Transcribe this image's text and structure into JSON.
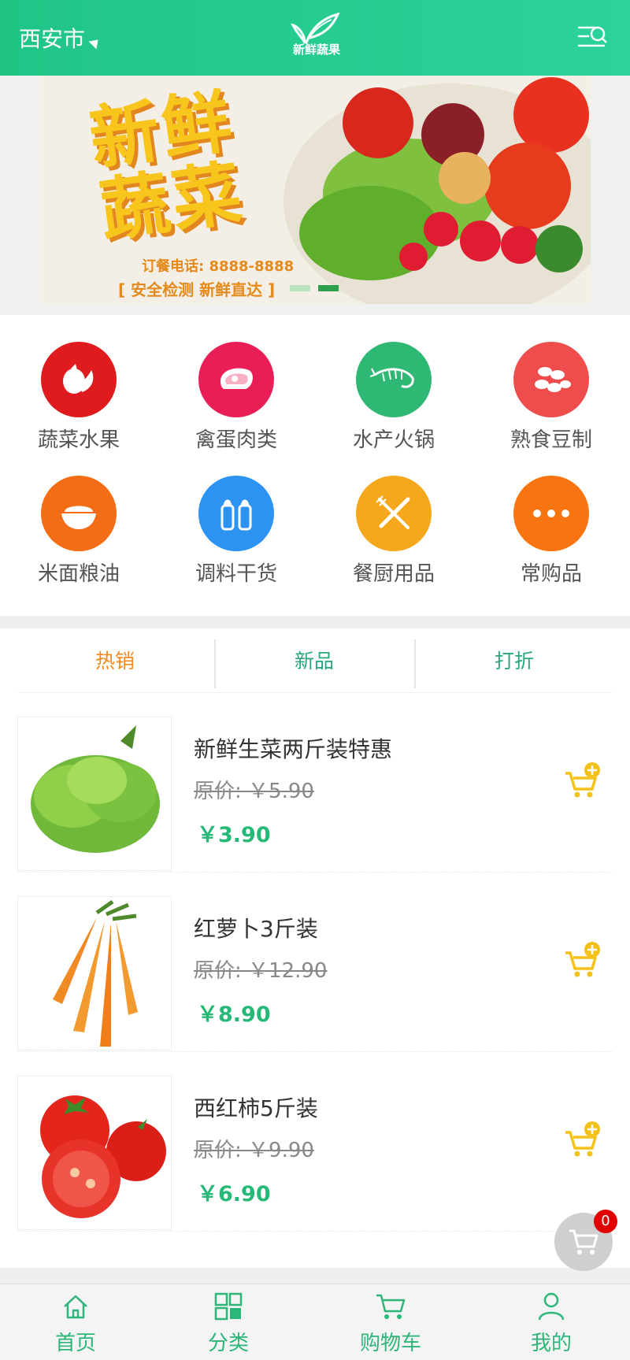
{
  "header": {
    "city": "西安市",
    "logo_text": "新鲜蔬果"
  },
  "banner": {
    "title": "新鲜蔬菜",
    "phone": "订餐电话: 8888-8888",
    "slogan": "[ 安全检测 新鲜直达 ]",
    "slides": 2,
    "active_slide": 2
  },
  "categories": [
    {
      "label": "蔬菜水果",
      "icon": "vegetable-icon",
      "color": "#e01b1f"
    },
    {
      "label": "禽蛋肉类",
      "icon": "meat-icon",
      "color": "#ea1e56"
    },
    {
      "label": "水产火锅",
      "icon": "shrimp-icon",
      "color": "#2eb874"
    },
    {
      "label": "熟食豆制",
      "icon": "beans-icon",
      "color": "#ef4c4c"
    },
    {
      "label": "米面粮油",
      "icon": "rice-bowl-icon",
      "color": "#f26d14"
    },
    {
      "label": "调料干货",
      "icon": "spice-bottles-icon",
      "color": "#2d93f2"
    },
    {
      "label": "餐厨用品",
      "icon": "fork-knife-icon",
      "color": "#f5a81c"
    },
    {
      "label": "常购品",
      "icon": "more-icon",
      "color": "#f77410"
    }
  ],
  "tabs": [
    {
      "label": "热销",
      "color": "#f28a1f"
    },
    {
      "label": "新品",
      "color": "#2aa77a"
    },
    {
      "label": "打折",
      "color": "#2aa77a"
    }
  ],
  "products": [
    {
      "name": "新鲜生菜两斤装特惠",
      "original": "原价: ￥5.90",
      "price": "￥3.90",
      "image": "lettuce"
    },
    {
      "name": "红萝卜3斤装",
      "original": "原价: ￥12.90",
      "price": "￥8.90",
      "image": "carrot"
    },
    {
      "name": "西红柿5斤装",
      "original": "原价: ￥9.90",
      "price": "￥6.90",
      "image": "tomato"
    }
  ],
  "cart_badge": "0",
  "bottom_nav": [
    {
      "label": "首页",
      "icon": "home-icon"
    },
    {
      "label": "分类",
      "icon": "category-icon"
    },
    {
      "label": "购物车",
      "icon": "cart-icon"
    },
    {
      "label": "我的",
      "icon": "user-icon"
    }
  ],
  "colors": {
    "brand": "#22c88c",
    "price": "#26b876",
    "add_cart": "#f5c11b"
  }
}
